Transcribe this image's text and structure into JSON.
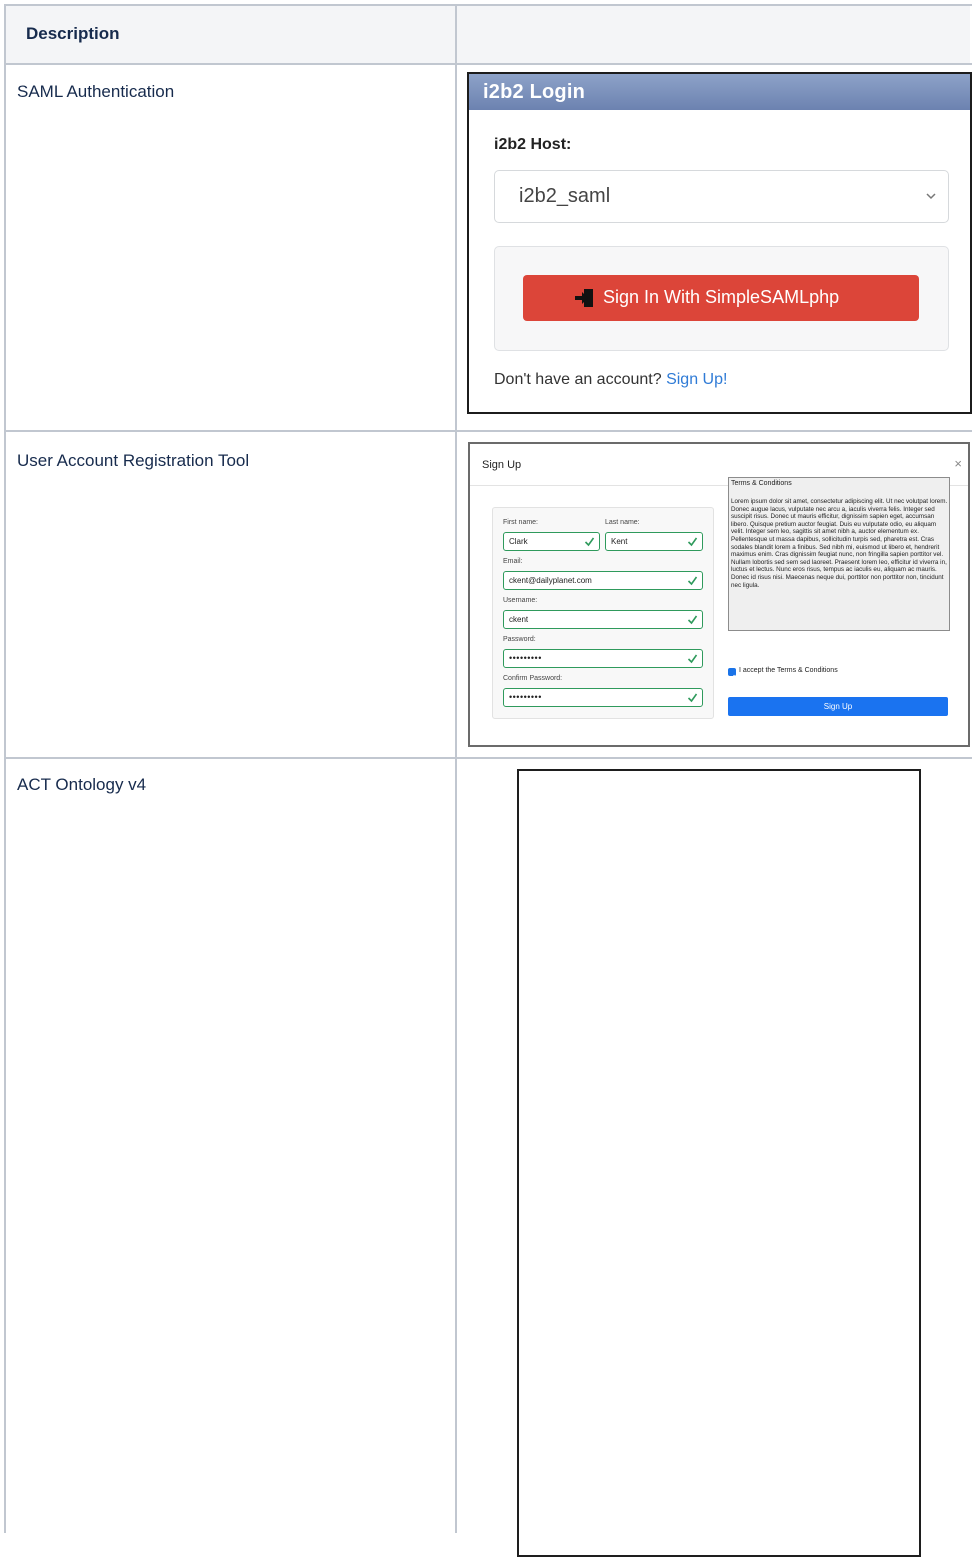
{
  "table": {
    "header": "Description",
    "rows": [
      {
        "label": "SAML Authentication"
      },
      {
        "label": "User Account Registration Tool"
      },
      {
        "label": "ACT Ontology v4"
      }
    ]
  },
  "login": {
    "title": "i2b2 Login",
    "host_label": "i2b2 Host:",
    "host_value": "i2b2_saml",
    "saml_button": "Sign In With SimpleSAMLphp",
    "no_account_text": "Don't have an account?",
    "signup_link": "Sign Up!",
    "button_color": "#dc4539"
  },
  "signup": {
    "title": "Sign Up",
    "close": "×",
    "fields": {
      "first_name_label": "First name:",
      "first_name": "Clark",
      "last_name_label": "Last name:",
      "last_name": "Kent",
      "email_label": "Email:",
      "email": "ckent@dailyplanet.com",
      "username_label": "Username:",
      "username": "ckent",
      "password_label": "Password:",
      "password": "•••••••••",
      "confirm_label": "Confirm Password:",
      "confirm": "•••••••••"
    },
    "terms_title": "Terms & Conditions",
    "terms_body": "Lorem ipsum dolor sit amet, consectetur adipiscing elit. Ut nec volutpat lorem. Donec augue lacus, vulputate nec arcu a, iaculis viverra felis. Integer sed suscipit risus. Donec ut mauris efficitur, dignissim sapien eget, accumsan libero. Quisque pretium auctor feugiat. Duis eu vulputate odio, eu aliquam velit. Integer sem leo, sagittis sit amet nibh a, auctor elementum ex. Pellentesque ut massa dapibus, sollicitudin turpis sed, pharetra est. Cras sodales blandit lorem a finibus. Sed nibh mi, euismod ut libero et, hendrerit maximus enim. Cras dignissim feugiat nunc, non fringilla sapien porttitor vel. Nullam lobortis sed sem sed laoreet. Praesent lorem leo, efficitur id viverra in, luctus et lectus. Nunc eros risus, tempus ac iaculis eu, aliquam ac mauris. Donec id risus nisi. Maecenas neque dui, porttitor non porttitor non, tincidunt nec ligula.",
    "accept_label": "I accept the Terms & Conditions",
    "accept_checked": true,
    "submit": "Sign Up",
    "valid_color": "#2f9a5c",
    "submit_color": "#1a73f0"
  }
}
